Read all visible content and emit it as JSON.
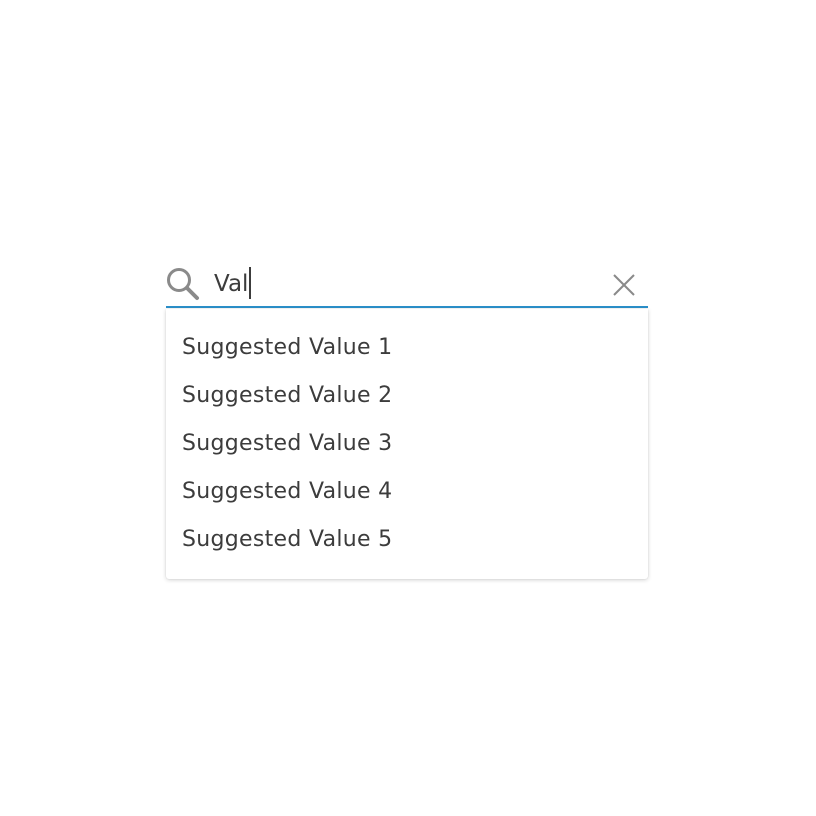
{
  "search": {
    "value": "Val",
    "accent_color": "#2b8fc9",
    "search_icon": "search-icon",
    "clear_icon": "close-icon"
  },
  "suggestions": [
    {
      "label": "Suggested Value 1"
    },
    {
      "label": "Suggested Value 2"
    },
    {
      "label": "Suggested Value 3"
    },
    {
      "label": "Suggested Value 4"
    },
    {
      "label": "Suggested Value 5"
    }
  ]
}
